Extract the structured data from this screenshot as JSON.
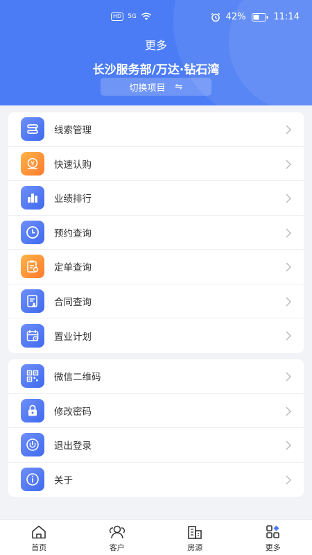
{
  "status_bar": {
    "hd": "HD",
    "signal": "5G",
    "battery": "42%",
    "time": "11:14"
  },
  "header": {
    "title": "更多",
    "project_name": "长沙服务部/万达·钻石湾",
    "switch_label": "切换项目",
    "switch_icon": "⇋",
    "background_color": "#4b7cf5"
  },
  "menu_group_1": [
    {
      "label": "线索管理",
      "icon": "route-icon",
      "color": "blue"
    },
    {
      "label": "快速认购",
      "icon": "yuan-coin-icon",
      "color": "orange"
    },
    {
      "label": "业绩排行",
      "icon": "bar-chart-icon",
      "color": "blue"
    },
    {
      "label": "预约查询",
      "icon": "clock-icon",
      "color": "blue"
    },
    {
      "label": "定单查询",
      "icon": "clipboard-search-icon",
      "color": "orange"
    },
    {
      "label": "合同查询",
      "icon": "contract-icon",
      "color": "blue"
    },
    {
      "label": "置业计划",
      "icon": "calendar-icon",
      "color": "blue"
    }
  ],
  "menu_group_2": [
    {
      "label": "微信二维码",
      "icon": "qr-code-icon",
      "color": "blue"
    },
    {
      "label": "修改密码",
      "icon": "lock-icon",
      "color": "blue"
    },
    {
      "label": "退出登录",
      "icon": "power-icon",
      "color": "blue"
    },
    {
      "label": "关于",
      "icon": "info-icon",
      "color": "blue"
    }
  ],
  "tabbar": [
    {
      "label": "首页",
      "icon": "home-icon"
    },
    {
      "label": "客户",
      "icon": "customers-icon"
    },
    {
      "label": "房源",
      "icon": "building-icon"
    },
    {
      "label": "更多",
      "icon": "more-grid-icon",
      "active": true
    }
  ]
}
